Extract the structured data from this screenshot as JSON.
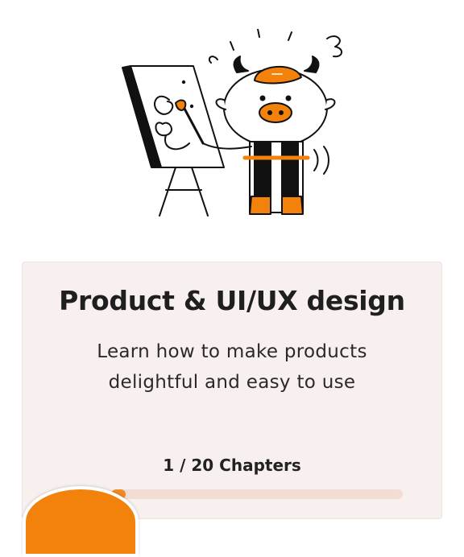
{
  "course": {
    "title": "Product & UI/UX design",
    "description_line1": "Learn how to make products",
    "description_line2": "delightful and easy to use",
    "chapters_label": "1 / 20 Chapters",
    "progress": {
      "current": 1,
      "total": 20
    }
  },
  "thumbnail": {
    "left_status": "",
    "right_status": ""
  },
  "colors": {
    "accent": "#f08a24",
    "card_bg": "#f7f0ee",
    "track": "#f3dcd3"
  },
  "illustration": {
    "icon": "cow-painter-illustration"
  }
}
